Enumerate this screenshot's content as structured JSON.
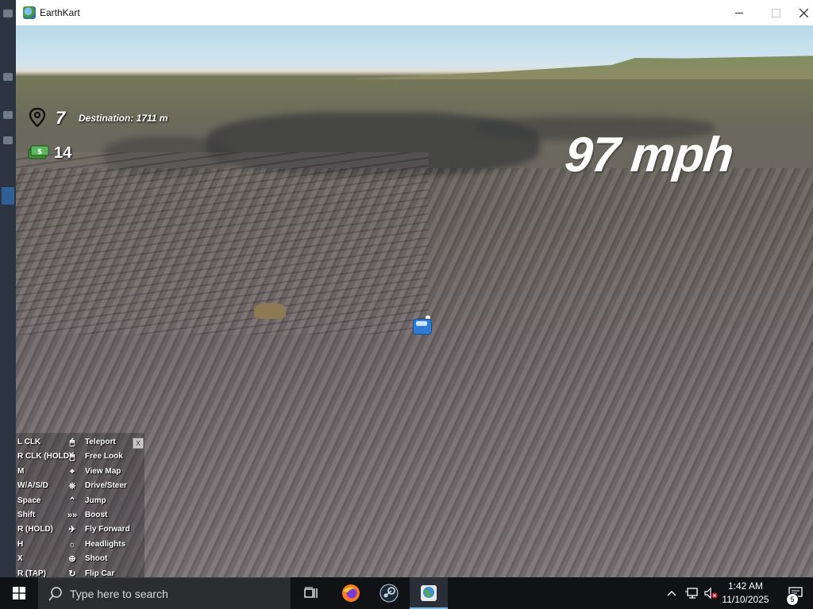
{
  "window": {
    "title": "EarthKart",
    "minimize_icon": "minimize-icon",
    "maximize_icon": "maximize-icon",
    "close_icon": "close-icon"
  },
  "hud": {
    "level_icon": "location-pin-icon",
    "level": "7",
    "destination": "Destination: 1711 m",
    "money_icon": "cash-icon",
    "money": "14",
    "speed": "97 mph"
  },
  "controls": {
    "close_label": "X",
    "rows": [
      {
        "key": "L CLK",
        "icon": "mouse-left-icon",
        "action": "Teleport"
      },
      {
        "key": "R CLK (HOLD)",
        "icon": "mouse-right-icon",
        "action": "Free Look"
      },
      {
        "key": "M",
        "icon": "map-icon",
        "action": "View Map"
      },
      {
        "key": "W/A/S/D",
        "icon": "steering-wheel-icon",
        "action": "Drive/Steer"
      },
      {
        "key": "Space",
        "icon": "jump-icon",
        "action": "Jump"
      },
      {
        "key": "Shift",
        "icon": "boost-chevrons-icon",
        "action": "Boost"
      },
      {
        "key": "R (HOLD)",
        "icon": "fly-icon",
        "action": "Fly Forward"
      },
      {
        "key": "H",
        "icon": "headlights-icon",
        "action": "Headlights"
      },
      {
        "key": "X",
        "icon": "crosshair-icon",
        "action": "Shoot"
      },
      {
        "key": "R (TAP)",
        "icon": "flip-icon",
        "action": "Flip Car"
      }
    ]
  },
  "taskbar": {
    "search_placeholder": "Type here to search",
    "apps": [
      "task-view-icon",
      "firefox-icon",
      "steam-icon",
      "earthkart-icon"
    ],
    "time": "1:42 AM",
    "date": "11/10/2025",
    "notification_count": "5"
  }
}
